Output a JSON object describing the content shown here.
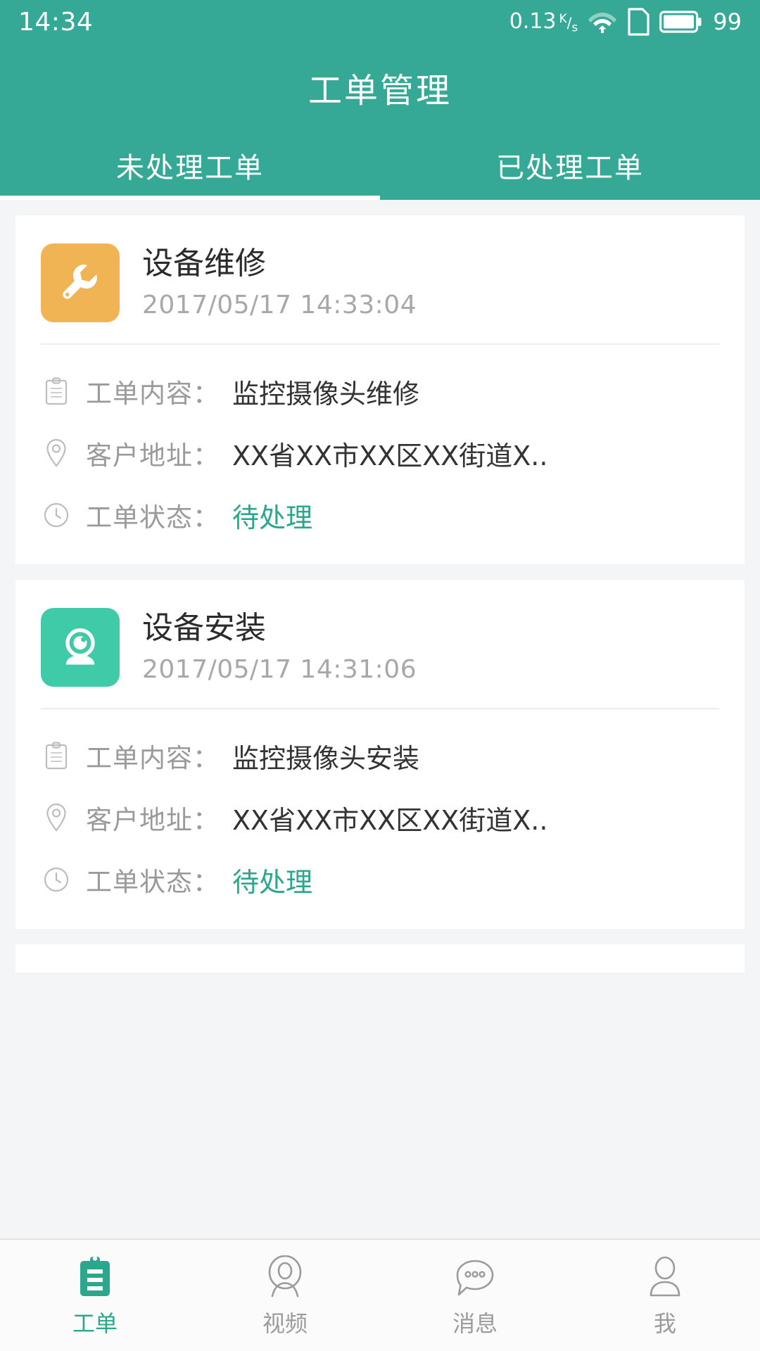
{
  "status_bar": {
    "time": "14:34",
    "network_speed": "0.13",
    "network_unit_top": "K",
    "network_unit_bottom": "s",
    "battery_percent": "99"
  },
  "header": {
    "title": "工单管理"
  },
  "tabs": [
    {
      "label": "未处理工单",
      "active": true
    },
    {
      "label": "已处理工单",
      "active": false
    }
  ],
  "colors": {
    "brand": "#35a995",
    "accent": "#2aa78c",
    "repair_icon_bg": "#f0b455",
    "install_icon_bg": "#3fcba8",
    "page_bg": "#f4f5f7"
  },
  "labels": {
    "content": "工单内容：",
    "address": "客户地址：",
    "status": "工单状态："
  },
  "cards": [
    {
      "title": "设备维修",
      "date": "2017/05/17 14:33:04",
      "icon": "wrench-icon",
      "icon_bg": "#f0b455",
      "content": "监控摄像头维修",
      "address": "XX省XX市XX区XX街道X..",
      "status": "待处理"
    },
    {
      "title": "设备安装",
      "date": "2017/05/17 14:31:06",
      "icon": "camera-icon",
      "icon_bg": "#3fcba8",
      "content": "监控摄像头安装",
      "address": "XX省XX市XX区XX街道X..",
      "status": "待处理"
    }
  ],
  "bottom_nav": [
    {
      "label": "工单",
      "icon": "clipboard-icon",
      "active": true
    },
    {
      "label": "视频",
      "icon": "video-person-icon",
      "active": false
    },
    {
      "label": "消息",
      "icon": "message-bubble-icon",
      "active": false
    },
    {
      "label": "我",
      "icon": "person-icon",
      "active": false
    }
  ]
}
